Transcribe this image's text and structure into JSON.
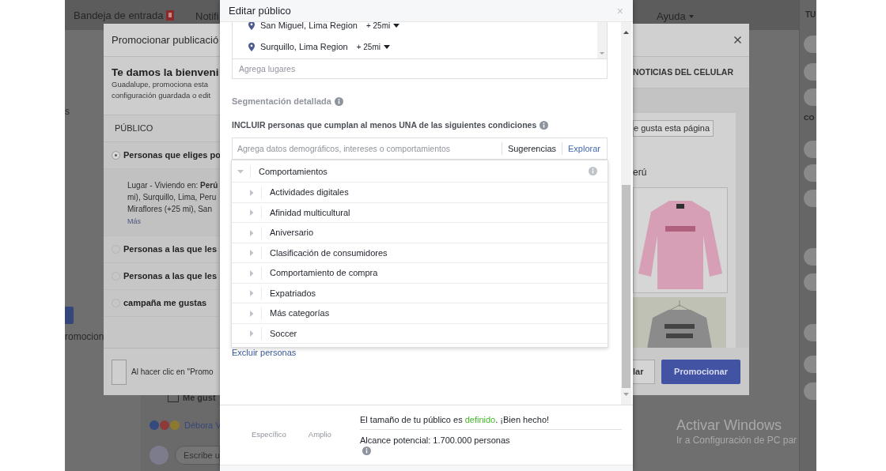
{
  "top_bar": {
    "inbox": "Bandeja de entrada",
    "notifications": "Notifi",
    "help": "Ayuda"
  },
  "left_column": {
    "text_1": "s",
    "text_2": "romocion"
  },
  "right_column": {
    "heading": "TU",
    "subheading": "CO"
  },
  "feed_post": {
    "like_button": "Me gust",
    "reactions_name": "Débora V",
    "comment_placeholder": "Escribe u"
  },
  "promote_dialog": {
    "title": "Promocionar publicació",
    "welcome": "Te damos la bienveni",
    "description_lines": [
      "Guadalupe, promociona esta",
      "configuración guardada o edit"
    ],
    "section_label": "PÚBLICO",
    "placement_tab": "NOTICIAS DEL CELULAR",
    "audiences": [
      {
        "label": "Personas que eliges po",
        "selected": true,
        "details": [
          "Lugar - Viviendo en: **Perú**",
          "mi), Surquillo, Lima, Peru",
          "Miraflores (+25 mi), San"
        ],
        "more_link": "Más"
      },
      {
        "label": "Personas a las que les",
        "selected": false
      },
      {
        "label": "Personas a las que les",
        "selected": false
      },
      {
        "label": "campaña me gustas",
        "selected": false
      }
    ],
    "preview": {
      "like_page_button": "e gusta esta página",
      "location_text": "erú"
    },
    "terms_text": "Al hacer clic en \"Promo",
    "cancel_button": "lar",
    "promote_button": "Promocionar"
  },
  "edit_audience_dialog": {
    "title": "Editar público",
    "close": "×",
    "locations": [
      {
        "name": "San Miguel, Lima Region",
        "radius": "+ 25mi"
      },
      {
        "name": "Surquillo, Lima Region",
        "radius": "+ 25mi"
      }
    ],
    "locations_placeholder": "Agrega lugares",
    "detailed_targeting_label": "Segmentación detallada",
    "include_label": "INCLUIR personas que cumplan al menos UNA de las siguientes condiciones",
    "search_placeholder": "Agrega datos demográficos, intereses o comportamientos",
    "search_tabs": [
      {
        "label": "Sugerencias",
        "selected": false
      },
      {
        "label": "Explorar",
        "selected": true
      }
    ],
    "browse_tree": [
      {
        "label": "Comportamientos",
        "expanded": true,
        "children": [
          {
            "label": "Actividades digitales",
            "expanded": false
          },
          {
            "label": "Afinidad multicultural",
            "expanded": false
          },
          {
            "label": "Aniversario",
            "expanded": false
          },
          {
            "label": "Clasificación de consumidores",
            "expanded": false
          },
          {
            "label": "Comportamiento de compra",
            "expanded": false
          },
          {
            "label": "Expatriados",
            "expanded": false
          },
          {
            "label": "Más categorías",
            "expanded": false
          },
          {
            "label": "Soccer",
            "expanded": false
          }
        ]
      }
    ],
    "exclude_link": "Excluir personas",
    "audience_meter": {
      "left_label": "Específico",
      "right_label": "Amplio"
    },
    "audience_status": {
      "text_before": "El tamaño de tu público es ",
      "status": "definido",
      "text_after": ". ¡Bien hecho!"
    },
    "potential_reach": "Alcance potencial: 1.700.000 personas"
  },
  "windows_notice": {
    "title": "Activar Windows",
    "subtitle": "Ir a Configuración de PC par"
  }
}
